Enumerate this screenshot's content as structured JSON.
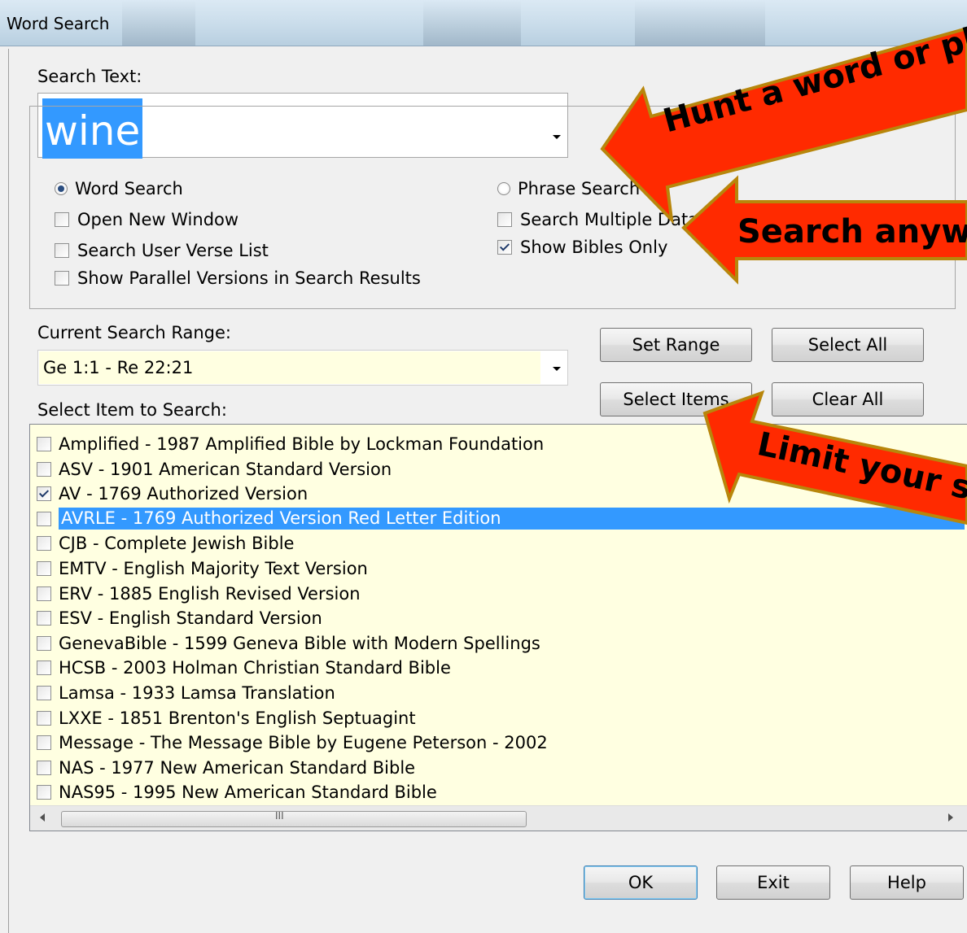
{
  "window": {
    "title": "Word Search"
  },
  "search": {
    "label": "Search Text:",
    "value": "wine"
  },
  "options": {
    "word_search": "Word Search",
    "phrase_search": "Phrase Search",
    "open_new_window": "Open New Window",
    "search_multiple": "Search Multiple Data",
    "search_user_verse_list": "Search User Verse List",
    "show_bibles_only": "Show Bibles Only",
    "show_parallel": "Show Parallel Versions in Search Results",
    "states": {
      "word_search": true,
      "phrase_search": false,
      "open_new_window": false,
      "search_multiple": false,
      "search_user_verse_list": false,
      "show_bibles_only": true,
      "show_parallel": false
    }
  },
  "range": {
    "label": "Current Search Range:",
    "value": "Ge 1:1 - Re 22:21"
  },
  "buttons": {
    "set_range": "Set Range",
    "select_all": "Select All",
    "select_items": "Select Items",
    "clear_all": "Clear All",
    "ok": "OK",
    "exit": "Exit",
    "help": "Help"
  },
  "items_label": "Select Item to Search:",
  "items": [
    {
      "text": "Amplified - 1987 Amplified Bible by Lockman Foundation",
      "checked": false,
      "selected": false
    },
    {
      "text": "ASV - 1901 American Standard Version",
      "checked": false,
      "selected": false
    },
    {
      "text": "AV - 1769 Authorized Version",
      "checked": true,
      "selected": false
    },
    {
      "text": "AVRLE - 1769 Authorized Version Red Letter Edition",
      "checked": false,
      "selected": true
    },
    {
      "text": "CJB - Complete Jewish Bible",
      "checked": false,
      "selected": false
    },
    {
      "text": "EMTV - English Majority Text Version",
      "checked": false,
      "selected": false
    },
    {
      "text": "ERV - 1885 English Revised Version",
      "checked": false,
      "selected": false
    },
    {
      "text": "ESV - English Standard Version",
      "checked": false,
      "selected": false
    },
    {
      "text": "GenevaBible - 1599 Geneva Bible with Modern Spellings",
      "checked": false,
      "selected": false
    },
    {
      "text": "HCSB - 2003 Holman Christian Standard Bible",
      "checked": false,
      "selected": false
    },
    {
      "text": "Lamsa - 1933 Lamsa Translation",
      "checked": false,
      "selected": false
    },
    {
      "text": "LXXE - 1851 Brenton's English Septuagint",
      "checked": false,
      "selected": false
    },
    {
      "text": "Message - The Message Bible by Eugene Peterson - 2002",
      "checked": false,
      "selected": false
    },
    {
      "text": "NAS - 1977 New American Standard Bible",
      "checked": false,
      "selected": false
    },
    {
      "text": "NAS95 - 1995 New American Standard Bible",
      "checked": false,
      "selected": false
    }
  ],
  "scrollbar": {
    "grip": "III"
  },
  "callouts": {
    "hunt": "Hunt a word or ph",
    "search_any": "Search anyw",
    "limit": "Limit your s"
  },
  "colors": {
    "callout_fill": "#ff2a00",
    "callout_border": "#b8860b",
    "selection": "#3399ff",
    "list_bg": "#ffffe1"
  }
}
